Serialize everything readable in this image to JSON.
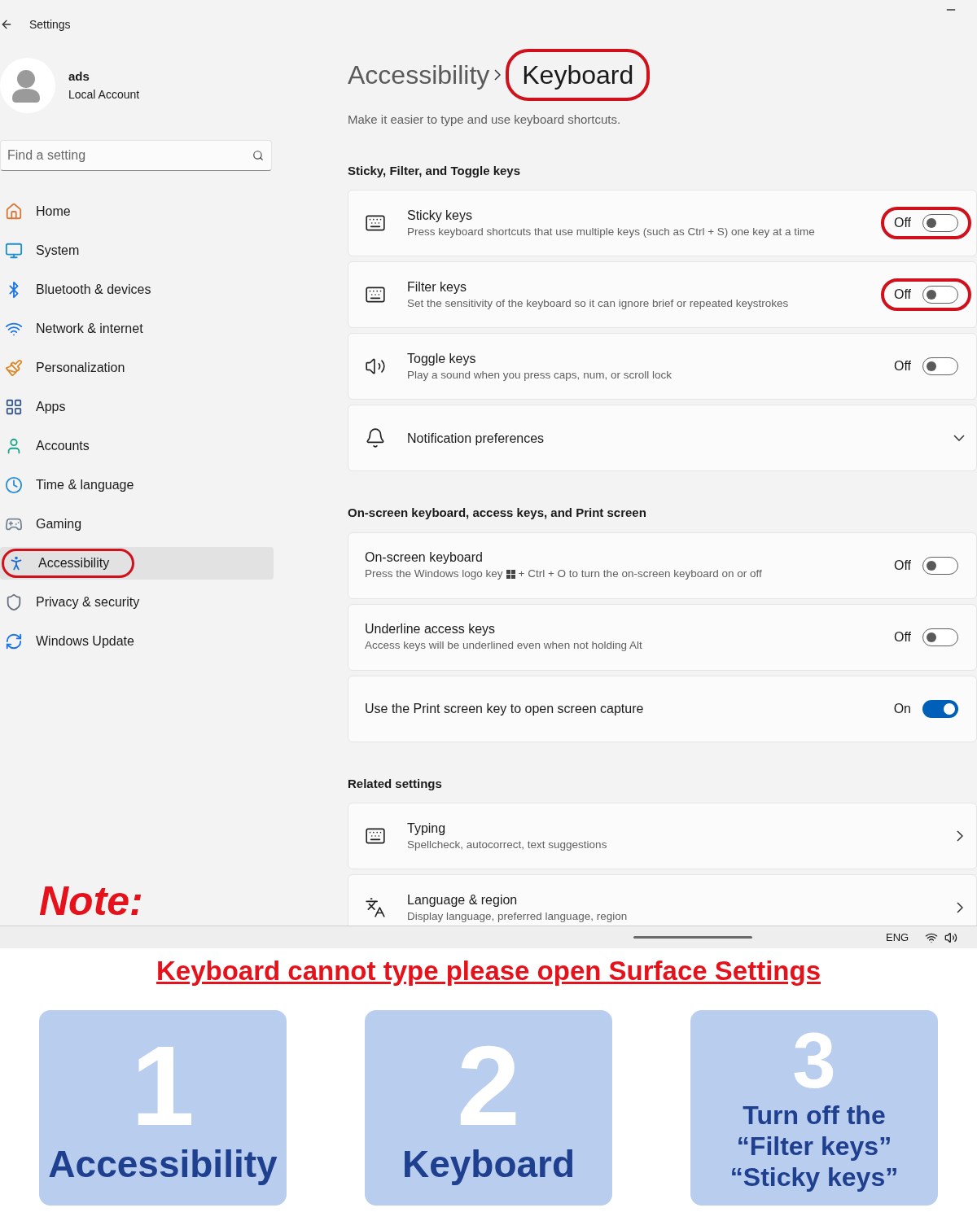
{
  "window": {
    "title": "Settings"
  },
  "user": {
    "name": "ads",
    "account_type": "Local Account"
  },
  "search": {
    "placeholder": "Find a setting"
  },
  "nav": {
    "items": [
      {
        "label": "Home",
        "selected": false,
        "highlighted": false
      },
      {
        "label": "System",
        "selected": false,
        "highlighted": false
      },
      {
        "label": "Bluetooth & devices",
        "selected": false,
        "highlighted": false
      },
      {
        "label": "Network & internet",
        "selected": false,
        "highlighted": false
      },
      {
        "label": "Personalization",
        "selected": false,
        "highlighted": false
      },
      {
        "label": "Apps",
        "selected": false,
        "highlighted": false
      },
      {
        "label": "Accounts",
        "selected": false,
        "highlighted": false
      },
      {
        "label": "Time & language",
        "selected": false,
        "highlighted": false
      },
      {
        "label": "Gaming",
        "selected": false,
        "highlighted": false
      },
      {
        "label": "Accessibility",
        "selected": true,
        "highlighted": true
      },
      {
        "label": "Privacy & security",
        "selected": false,
        "highlighted": false
      },
      {
        "label": "Windows Update",
        "selected": false,
        "highlighted": false
      }
    ]
  },
  "breadcrumb": {
    "parent": "Accessibility",
    "current": "Keyboard",
    "current_highlighted": true
  },
  "description": "Make it easier to type and use keyboard shortcuts.",
  "sections": [
    {
      "heading": "Sticky, Filter, and Toggle keys",
      "rows": [
        {
          "kind": "toggle",
          "title": "Sticky keys",
          "subtitle": "Press keyboard shortcuts that use multiple keys (such as Ctrl + S) one key at a time",
          "state_text": "Off",
          "on": false,
          "highlighted": true
        },
        {
          "kind": "toggle",
          "title": "Filter keys",
          "subtitle": "Set the sensitivity of the keyboard so it can ignore brief or repeated keystrokes",
          "state_text": "Off",
          "on": false,
          "highlighted": true
        },
        {
          "kind": "toggle",
          "title": "Toggle keys",
          "subtitle": "Play a sound when you press caps, num, or scroll lock",
          "state_text": "Off",
          "on": false,
          "highlighted": false
        },
        {
          "kind": "expand",
          "title": "Notification preferences"
        }
      ]
    },
    {
      "heading": "On-screen keyboard, access keys, and Print screen",
      "rows": [
        {
          "kind": "toggle",
          "title": "On-screen keyboard",
          "subtitle": "Press the Windows logo key",
          "subtitle_after_logo": "+ Ctrl + O to turn the on-screen keyboard on or off",
          "state_text": "Off",
          "on": false,
          "highlighted": false
        },
        {
          "kind": "toggle",
          "title": "Underline access keys",
          "subtitle": "Access keys will be underlined even when not holding Alt",
          "state_text": "Off",
          "on": false,
          "highlighted": false
        },
        {
          "kind": "toggle",
          "title": "Use the Print screen key to open screen capture",
          "state_text": "On",
          "on": true,
          "highlighted": false
        }
      ]
    },
    {
      "heading": "Related settings",
      "rows": [
        {
          "kind": "link",
          "title": "Typing",
          "subtitle": "Spellcheck, autocorrect, text suggestions"
        },
        {
          "kind": "link",
          "title": "Language & region",
          "subtitle": "Display language, preferred language, region"
        }
      ]
    }
  ],
  "taskbar": {
    "language": "ENG"
  },
  "note": {
    "label": "Note:",
    "headline": "Keyboard cannot type please open Surface Settings",
    "steps": [
      {
        "number": "1",
        "text": "Accessibility"
      },
      {
        "number": "2",
        "text": "Keyboard"
      },
      {
        "number": "3",
        "text": "Turn off the\n“Filter keys”\n“Sticky keys”"
      }
    ]
  }
}
